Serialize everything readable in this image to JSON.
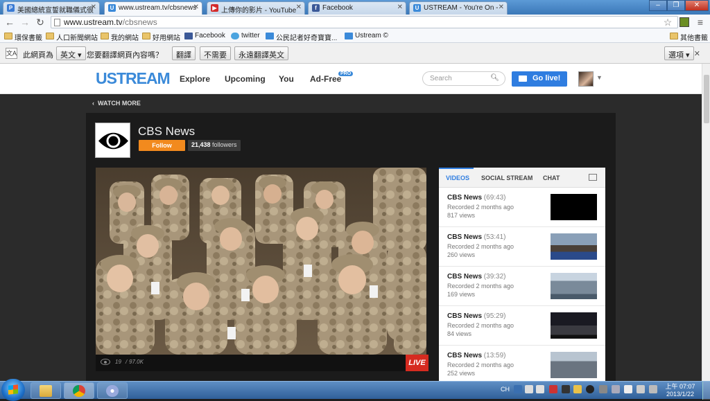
{
  "browser": {
    "tabs": [
      {
        "label": "美國總統宣誓就職儀式很",
        "favicon": "P"
      },
      {
        "label": "www.ustream.tv/cbsnews",
        "favicon": "U"
      },
      {
        "label": "上傳你的影片 - YouTube",
        "favicon": "▶"
      },
      {
        "label": "Facebook",
        "favicon": "f"
      },
      {
        "label": "USTREAM - You're On -",
        "favicon": "U"
      }
    ],
    "url_domain": "www.ustream.tv",
    "url_path": "/cbsnews",
    "window_buttons": [
      "‒",
      "❐",
      "✕"
    ],
    "bookmarks": [
      "環保書籤",
      "人口新聞網站",
      "我的網站",
      "好用網站",
      "Facebook",
      "twitter",
      "公民記者好奇寶寶...",
      "Ustream ©"
    ],
    "other_bookmarks": "其他書籤"
  },
  "translate_bar": {
    "prefix": "此網頁為",
    "language": "英文 ▾",
    "question": "您要翻譯網頁內容嗎？",
    "translate": "翻譯",
    "no": "不需要",
    "always": "永遠翻譯英文",
    "options": "選項 ▾",
    "close": "✕"
  },
  "ustream": {
    "logo": "USTREAM",
    "nav": [
      "Explore",
      "Upcoming",
      "You",
      "Ad-Free"
    ],
    "pro_badge": "PRO",
    "search_placeholder": "Search",
    "go_live": "Go live!",
    "watch_more": "WATCH MORE"
  },
  "channel": {
    "name": "CBS News",
    "follow": "Follow",
    "followers_count": "21,438",
    "followers_label": "followers"
  },
  "player": {
    "viewers_now": "19",
    "viewers_total": "97.0K",
    "live": "LIVE"
  },
  "sidebar": {
    "tabs": [
      "VIDEOS",
      "SOCIAL STREAM",
      "CHAT"
    ],
    "videos": [
      {
        "title": "CBS News",
        "duration": "(69:43)",
        "recorded": "Recorded 2 months ago",
        "views": "817 views"
      },
      {
        "title": "CBS News",
        "duration": "(53:41)",
        "recorded": "Recorded 2 months ago",
        "views": "260 views"
      },
      {
        "title": "CBS News",
        "duration": "(39:32)",
        "recorded": "Recorded 2 months ago",
        "views": "169 views"
      },
      {
        "title": "CBS News",
        "duration": "(95:29)",
        "recorded": "Recorded 2 months ago",
        "views": "84 views"
      },
      {
        "title": "CBS News",
        "duration": "(13:59)",
        "recorded": "Recorded 2 months ago",
        "views": "252 views"
      }
    ]
  },
  "taskbar": {
    "lang": "CH",
    "time": "上午 07:07",
    "date": "2013/1/22"
  },
  "colors": {
    "ustream_blue": "#3b8ad9",
    "follow_orange": "#f28a1e",
    "live_red": "#d62b20"
  }
}
